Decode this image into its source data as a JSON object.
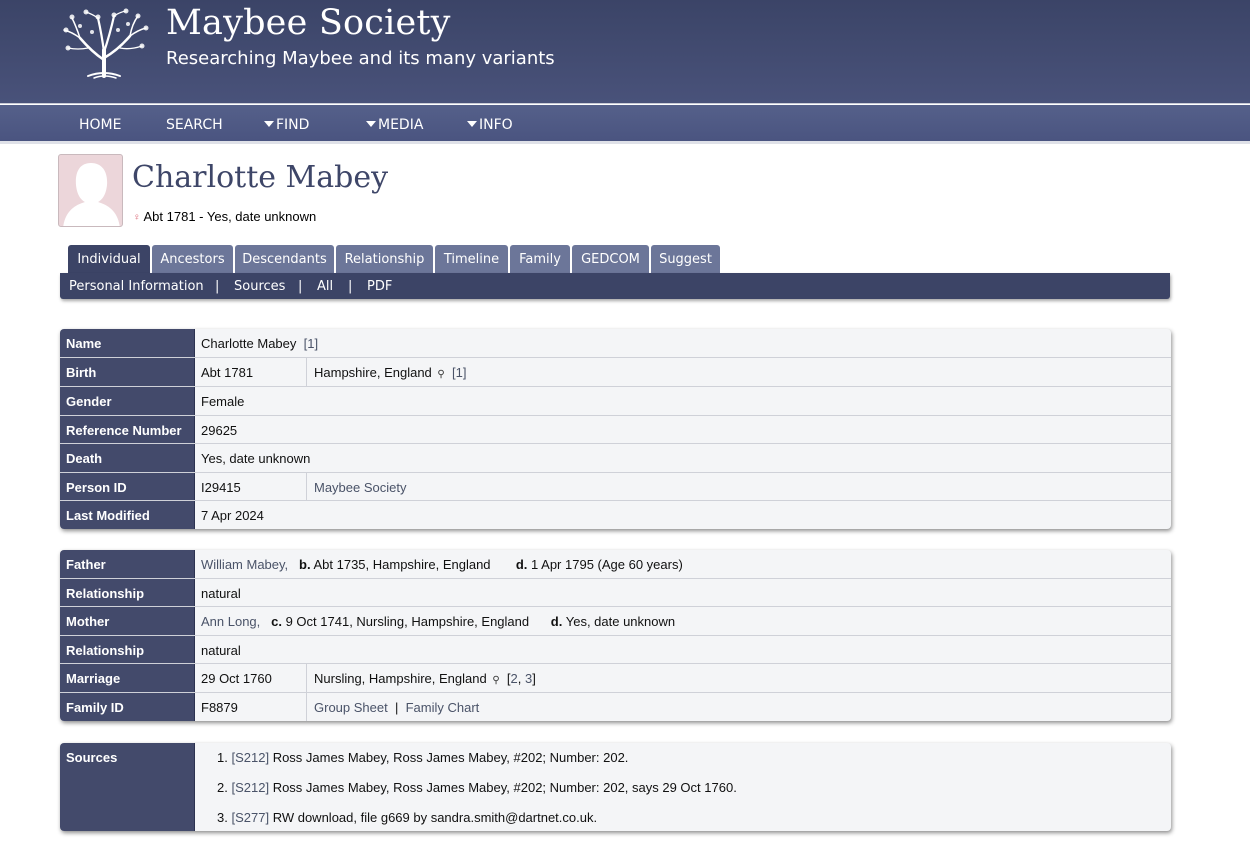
{
  "site": {
    "title": "Maybee Society",
    "subtitle": "Researching Maybee and its many variants"
  },
  "nav": {
    "home": "HOME",
    "search": "SEARCH",
    "find": "FIND",
    "media": "MEDIA",
    "info": "INFO"
  },
  "person": {
    "name": "Charlotte Mabey",
    "dates": "Abt 1781 - Yes, date unknown"
  },
  "tabs": {
    "individual": "Individual",
    "ancestors": "Ancestors",
    "descendants": "Descendants",
    "relationship": "Relationship",
    "timeline": "Timeline",
    "family": "Family",
    "gedcom": "GEDCOM",
    "suggest": "Suggest"
  },
  "subnav": {
    "personal": "Personal Information",
    "sources": "Sources",
    "all": "All",
    "pdf": "PDF",
    "sep": "|"
  },
  "individual": {
    "name_label": "Name",
    "name_value": "Charlotte Mabey",
    "name_cite": "[1]",
    "birth_label": "Birth",
    "birth_date": "Abt 1781",
    "birth_place": "Hampshire, England",
    "birth_cite": "[1]",
    "gender_label": "Gender",
    "gender_value": "Female",
    "ref_label": "Reference Number",
    "ref_value": "29625",
    "death_label": "Death",
    "death_value": "Yes, date unknown",
    "pid_label": "Person ID",
    "pid_value": "I29415",
    "pid_tree": "Maybee Society",
    "mod_label": "Last Modified",
    "mod_value": "7 Apr 2024"
  },
  "family": {
    "father_label": "Father",
    "father_name": "William Mabey,",
    "father_b": "b.",
    "father_birth": "Abt 1735, Hampshire, England",
    "father_d": "d.",
    "father_death": "1 Apr 1795 (Age 60 years)",
    "rel1_label": "Relationship",
    "rel1_value": "natural",
    "mother_label": "Mother",
    "mother_name": "Ann Long,",
    "mother_c": "c.",
    "mother_chr": "9 Oct 1741, Nursling, Hampshire, England",
    "mother_d": "d.",
    "mother_death": "Yes, date unknown",
    "rel2_label": "Relationship",
    "rel2_value": "natural",
    "marr_label": "Marriage",
    "marr_date": "29 Oct 1760",
    "marr_place": "Nursling, Hampshire, England",
    "marr_cite_open": "[",
    "marr_cite_2": "2",
    "marr_cite_sep": ", ",
    "marr_cite_3": "3",
    "marr_cite_close": "]",
    "fid_label": "Family ID",
    "fid_value": "F8879",
    "group_sheet": "Group Sheet",
    "chart_sep": "|",
    "family_chart": "Family Chart"
  },
  "sources": {
    "label": "Sources",
    "items": [
      {
        "num": "1.",
        "id": "[S212]",
        "text": "Ross James Mabey, Ross James Mabey, #202; Number: 202."
      },
      {
        "num": "2.",
        "id": "[S212]",
        "text": "Ross James Mabey, Ross James Mabey, #202; Number: 202, says 29 Oct 1760."
      },
      {
        "num": "3.",
        "id": "[S277]",
        "text": "RW download, file g669 by sandra.smith@dartnet.co.uk."
      }
    ]
  },
  "colors": {
    "header": "#434a6b",
    "tab_inactive": "#6c7699",
    "tab_active": "#3c4466",
    "label_bg": "#434a6b",
    "value_bg": "#f4f5f7",
    "link": "#4a5368",
    "female_marker": "#d9606f"
  },
  "icons": [
    "tree-logo-icon",
    "female-icon",
    "magnifier-icon",
    "caret-down-icon"
  ]
}
